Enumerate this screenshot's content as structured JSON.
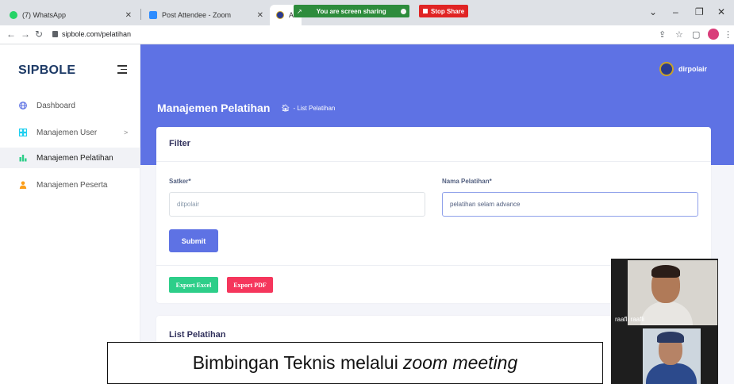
{
  "browser": {
    "tabs": [
      {
        "label": "(7) WhatsApp",
        "icon": "whatsapp-icon"
      },
      {
        "label": "Post Attendee - Zoom",
        "icon": "zoom-icon"
      },
      {
        "label": "AD",
        "icon": "site-icon"
      }
    ],
    "url": "sipbole.com/pelatihan"
  },
  "screenshare": {
    "status": "You are screen sharing",
    "stop_label": "Stop Share"
  },
  "sidebar": {
    "brand": "SIPBOLE",
    "items": [
      {
        "label": "Dashboard",
        "icon": "globe-icon"
      },
      {
        "label": "Manajemen User",
        "icon": "users-icon",
        "chevron": ">"
      },
      {
        "label": "Manajemen Pelatihan",
        "icon": "training-icon"
      },
      {
        "label": "Manajemen Peserta",
        "icon": "person-icon"
      }
    ]
  },
  "header": {
    "username": "dirpolair",
    "title": "Manajemen Pelatihan",
    "breadcrumb": "- List Pelatihan"
  },
  "filter": {
    "title": "Filter",
    "satker_label": "Satker*",
    "satker_value": "ditpolair",
    "nama_label": "Nama Pelatihan*",
    "nama_value": "pelatihan selam advance",
    "submit": "Submit",
    "export_excel": "Export Excel",
    "export_pdf": "Export PDF"
  },
  "list": {
    "title": "List Pelatihan"
  },
  "video": {
    "participant_name": "raafli raafli"
  },
  "caption": {
    "text": "Bimbingan Teknis melalui",
    "italic": "zoom meeting"
  },
  "colors": {
    "primary": "#5e72e4",
    "success": "#2dce89",
    "danger": "#f5365c",
    "brand": "#1d3a66"
  }
}
